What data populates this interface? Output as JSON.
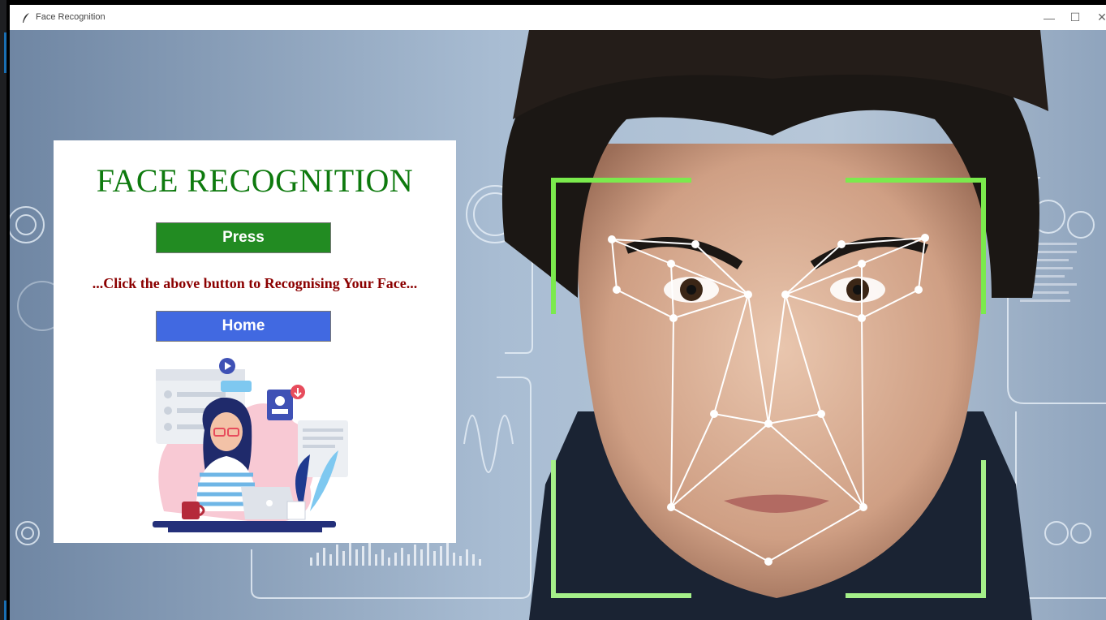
{
  "window": {
    "title": "Face Recognition",
    "controls": {
      "minimize": "—",
      "maximize": "☐",
      "close": "✕"
    }
  },
  "panel": {
    "title": "FACE RECOGNITION",
    "press_label": "Press",
    "hint": "...Click the above button to Recognising Your Face...",
    "home_label": "Home"
  },
  "colors": {
    "title_green": "#0e7a0e",
    "press_button": "#228b22",
    "home_button": "#4169e1",
    "hint_text": "#8b0000",
    "scan_frame": "#7bea4d"
  },
  "icons": {
    "app_icon": "feather-icon",
    "background": "face-scan-background-image",
    "illustration": "woman-at-laptop-illustration"
  }
}
